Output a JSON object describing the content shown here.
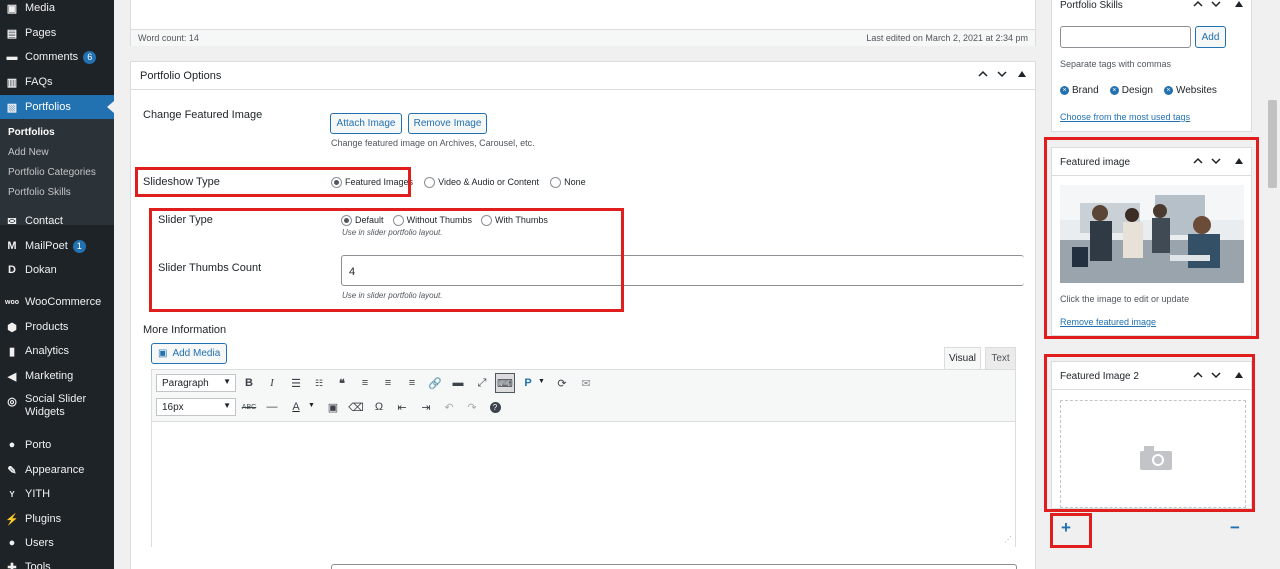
{
  "sidebar": {
    "menu": [
      {
        "icon": "media-icon",
        "label": "Media"
      },
      {
        "icon": "pages-icon",
        "label": "Pages"
      },
      {
        "icon": "comments-icon",
        "label": "Comments",
        "badge": "6"
      },
      {
        "icon": "faqs-icon",
        "label": "FAQs"
      },
      {
        "icon": "portfolios-icon",
        "label": "Portfolios"
      },
      {
        "icon": "contact-icon",
        "label": "Contact"
      },
      {
        "icon": "mailpoet-icon",
        "label": "MailPoet",
        "badge": "1"
      },
      {
        "icon": "dokan-icon",
        "label": "Dokan"
      },
      {
        "icon": "woocommerce-icon",
        "label": "WooCommerce"
      },
      {
        "icon": "products-icon",
        "label": "Products"
      },
      {
        "icon": "analytics-icon",
        "label": "Analytics"
      },
      {
        "icon": "marketing-icon",
        "label": "Marketing"
      },
      {
        "icon": "social-slider-icon",
        "label": "Social Slider",
        "label2": "Widgets"
      },
      {
        "icon": "porto-icon",
        "label": "Porto"
      },
      {
        "icon": "appearance-icon",
        "label": "Appearance"
      },
      {
        "icon": "yith-icon",
        "label": "YITH"
      },
      {
        "icon": "plugins-icon",
        "label": "Plugins"
      },
      {
        "icon": "users-icon",
        "label": "Users"
      },
      {
        "icon": "tools-icon",
        "label": "Tools"
      }
    ],
    "submenu": [
      "Portfolios",
      "Add New",
      "Portfolio Categories",
      "Portfolio Skills"
    ]
  },
  "editor_status": {
    "word_count": "Word count: 14",
    "last_edited": "Last edited on March 2, 2021 at 2:34 pm"
  },
  "portfolio_options": {
    "title": "Portfolio Options",
    "change_featured_label": "Change Featured Image",
    "attach_button": "Attach Image",
    "remove_button": "Remove Image",
    "change_featured_help": "Change featured image on Archives, Carousel, etc.",
    "slideshow_label": "Slideshow Type",
    "slideshow_options": [
      "Featured Images",
      "Video & Audio or Content",
      "None"
    ],
    "slideshow_selected": "Featured Images",
    "slider_type_label": "Slider Type",
    "slider_type_options": [
      "Default",
      "Without Thumbs",
      "With Thumbs"
    ],
    "slider_type_selected": "Default",
    "slider_type_help": "Use in slider portfolio layout.",
    "thumbs_count_label": "Slider Thumbs Count",
    "thumbs_count_value": "4",
    "thumbs_count_help": "Use in slider portfolio layout.",
    "more_info_label": "More Information",
    "add_media_button": "Add Media",
    "tab_visual": "Visual",
    "tab_text": "Text",
    "format_select": "Paragraph",
    "font_size_select": "16px"
  },
  "portfolio_skills": {
    "title": "Portfolio Skills",
    "add_button": "Add",
    "help": "Separate tags with commas",
    "tags": [
      "Brand",
      "Design",
      "Websites"
    ],
    "choose_link": "Choose from the most used tags"
  },
  "featured_image": {
    "title": "Featured image",
    "caption": "Click the image to edit or update",
    "remove_link": "Remove featured image"
  },
  "featured_image_2": {
    "title": "Featured Image 2",
    "add_symbol": "+",
    "remove_symbol": "−"
  },
  "colors": {
    "accent": "#2271b1",
    "highlight_box": "#e01e1e",
    "sidebar_bg": "#1d2327"
  }
}
